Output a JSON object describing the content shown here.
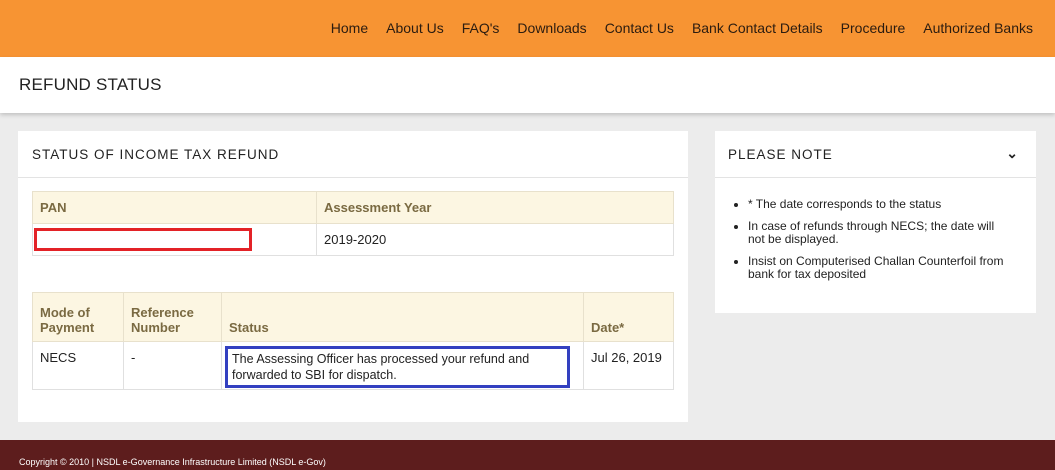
{
  "nav": {
    "items": [
      "Home",
      "About Us",
      "FAQ's",
      "Downloads",
      "Contact Us",
      "Bank Contact Details",
      "Procedure",
      "Authorized Banks"
    ]
  },
  "page_title": "REFUND STATUS",
  "main": {
    "title": "STATUS OF INCOME TAX REFUND",
    "table1": {
      "headers": [
        "PAN",
        "Assessment Year"
      ],
      "row": {
        "pan": "",
        "assessment_year": "2019-2020"
      }
    },
    "table2": {
      "headers": [
        "Mode of Payment",
        "Reference Number",
        "Status",
        "Date*"
      ],
      "row": {
        "mode": "NECS",
        "reference": "-",
        "status": "The Assessing Officer has processed your refund and forwarded to SBI for dispatch.",
        "date": "Jul 26, 2019"
      }
    }
  },
  "note": {
    "title": "PLEASE NOTE",
    "items": [
      "* The date corresponds to the status",
      "In case of refunds through NECS; the date will not be displayed.",
      "Insist on Computerised Challan Counterfoil from bank for tax deposited"
    ]
  },
  "footer": {
    "text": "Copyright © 2010 | NSDL e-Governance Infrastructure Limited (NSDL e-Gov)"
  },
  "colors": {
    "topbar": "#f79433",
    "footer": "#5d1d1d",
    "pan_highlight": "#e32227",
    "status_highlight": "#3340c0",
    "table_header_bg": "#fcf6e2"
  },
  "icons": {
    "collapse": "chevron-down-icon"
  }
}
